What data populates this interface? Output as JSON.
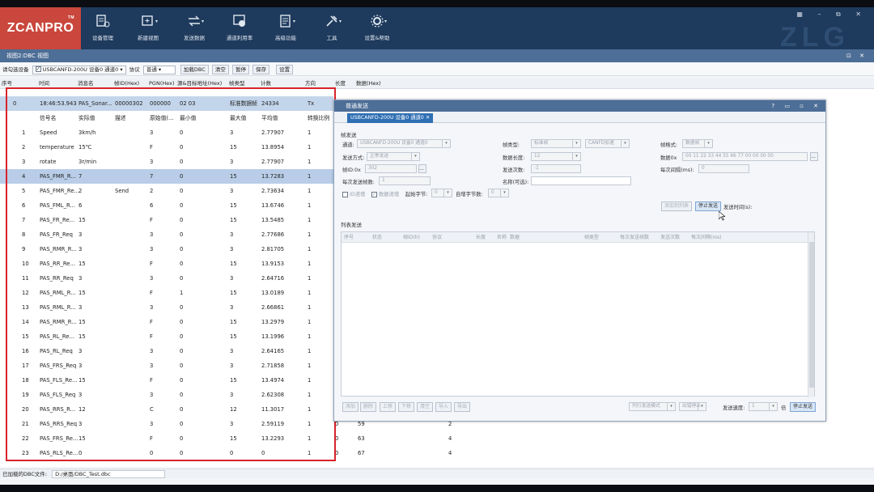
{
  "app": {
    "logo": "ZCANPRO",
    "logo_tm": "TM",
    "watermark": "ZLG",
    "ribbon": [
      {
        "label": "设备管理",
        "icon": "device-manage-icon"
      },
      {
        "label": "新建视图",
        "icon": "new-view-icon"
      },
      {
        "label": "发送数据",
        "icon": "send-data-icon"
      },
      {
        "label": "通道利用率",
        "icon": "channel-usage-icon"
      },
      {
        "label": "高级功能",
        "icon": "advanced-icon"
      },
      {
        "label": "工具",
        "icon": "tools-icon"
      },
      {
        "label": "设置&帮助",
        "icon": "settings-help-icon"
      }
    ]
  },
  "window": {
    "title": "视图2:DBC 视图",
    "controls": "⊡ ✕"
  },
  "toolbar": {
    "device_label": "请勾选设备",
    "device_value": "USBCANFD-200U 设备0 通道0",
    "protocol_label": "协议",
    "protocol_value": "普通",
    "buttons": [
      "加载DBC",
      "清空",
      "暂停",
      "保存",
      "设置"
    ]
  },
  "grid": {
    "headers": [
      "序号",
      "时间",
      "消息名",
      "帧ID(Hex)",
      "PGN(Hex)",
      "源&目标地址(Hex)",
      "帧类型",
      "计数",
      "方向",
      "长度",
      "数据(Hex)"
    ],
    "sub_headers": [
      "信号名",
      "实际值",
      "描述",
      "原始值(...",
      "最小值",
      "最大值",
      "平均值",
      "转换比例"
    ],
    "main_row": {
      "index": "0",
      "time": "18:46:53.943",
      "name": "PAS_Sonar...",
      "id": "00000302",
      "pgn": "000000",
      "addr": "02 03",
      "type": "标准数据帧",
      "count": "24334",
      "dir": "Tx"
    },
    "rows": [
      {
        "idx": "1",
        "name": "Speed",
        "value": "3km/h",
        "desc": "",
        "raw": "3",
        "min": "0",
        "max": "3",
        "avg": "2.77907",
        "ratio": "1"
      },
      {
        "idx": "2",
        "name": "temperature",
        "value": "15℃",
        "desc": "",
        "raw": "F",
        "min": "0",
        "max": "15",
        "avg": "13.8954",
        "ratio": "1"
      },
      {
        "idx": "3",
        "name": "rotate",
        "value": "3r/min",
        "desc": "",
        "raw": "3",
        "min": "0",
        "max": "3",
        "avg": "2.77907",
        "ratio": "1"
      },
      {
        "idx": "4",
        "name": "PAS_FMR_R...",
        "value": "7",
        "desc": "",
        "raw": "7",
        "min": "0",
        "max": "15",
        "avg": "13.7283",
        "ratio": "1"
      },
      {
        "idx": "5",
        "name": "PAS_FMR_Re...",
        "value": "2",
        "desc": "Send",
        "raw": "2",
        "min": "0",
        "max": "3",
        "avg": "2.73634",
        "ratio": "1"
      },
      {
        "idx": "6",
        "name": "PAS_FML_R...",
        "value": "6",
        "desc": "",
        "raw": "6",
        "min": "0",
        "max": "15",
        "avg": "13.6746",
        "ratio": "1"
      },
      {
        "idx": "7",
        "name": "PAS_FR_Re...",
        "value": "15",
        "desc": "",
        "raw": "F",
        "min": "0",
        "max": "15",
        "avg": "13.5485",
        "ratio": "1"
      },
      {
        "idx": "8",
        "name": "PAS_FR_Req",
        "value": "3",
        "desc": "",
        "raw": "3",
        "min": "0",
        "max": "3",
        "avg": "2.77686",
        "ratio": "1"
      },
      {
        "idx": "9",
        "name": "PAS_RMR_R...",
        "value": "3",
        "desc": "",
        "raw": "3",
        "min": "0",
        "max": "3",
        "avg": "2.81705",
        "ratio": "1"
      },
      {
        "idx": "10",
        "name": "PAS_RR_Re...",
        "value": "15",
        "desc": "",
        "raw": "F",
        "min": "0",
        "max": "15",
        "avg": "13.9153",
        "ratio": "1"
      },
      {
        "idx": "11",
        "name": "PAS_RR_Req",
        "value": "3",
        "desc": "",
        "raw": "3",
        "min": "0",
        "max": "3",
        "avg": "2.64716",
        "ratio": "1"
      },
      {
        "idx": "12",
        "name": "PAS_RML_R...",
        "value": "15",
        "desc": "",
        "raw": "F",
        "min": "1",
        "max": "15",
        "avg": "13.0189",
        "ratio": "1"
      },
      {
        "idx": "13",
        "name": "PAS_RML_R...",
        "value": "3",
        "desc": "",
        "raw": "3",
        "min": "0",
        "max": "3",
        "avg": "2.66861",
        "ratio": "1"
      },
      {
        "idx": "14",
        "name": "PAS_RMR_R...",
        "value": "15",
        "desc": "",
        "raw": "F",
        "min": "0",
        "max": "15",
        "avg": "13.2979",
        "ratio": "1"
      },
      {
        "idx": "15",
        "name": "PAS_RL_Re...",
        "value": "15",
        "desc": "",
        "raw": "F",
        "min": "0",
        "max": "15",
        "avg": "13.1996",
        "ratio": "1"
      },
      {
        "idx": "16",
        "name": "PAS_RL_Req",
        "value": "3",
        "desc": "",
        "raw": "3",
        "min": "0",
        "max": "3",
        "avg": "2.64165",
        "ratio": "1"
      },
      {
        "idx": "17",
        "name": "PAS_FRS_Req",
        "value": "3",
        "desc": "",
        "raw": "3",
        "min": "0",
        "max": "3",
        "avg": "2.71858",
        "ratio": "1"
      },
      {
        "idx": "18",
        "name": "PAS_FLS_Re...",
        "value": "15",
        "desc": "",
        "raw": "F",
        "min": "0",
        "max": "15",
        "avg": "13.4974",
        "ratio": "1"
      },
      {
        "idx": "19",
        "name": "PAS_FLS_Req",
        "value": "3",
        "desc": "",
        "raw": "3",
        "min": "0",
        "max": "3",
        "avg": "2.62308",
        "ratio": "1"
      },
      {
        "idx": "20",
        "name": "PAS_RRS_R...",
        "value": "12",
        "desc": "",
        "raw": "C",
        "min": "0",
        "max": "12",
        "avg": "11.3017",
        "ratio": "1"
      },
      {
        "idx": "21",
        "name": "PAS_RRS_Req",
        "value": "3",
        "desc": "",
        "raw": "3",
        "min": "0",
        "max": "3",
        "avg": "2.59119",
        "ratio": "1"
      },
      {
        "idx": "22",
        "name": "PAS_FRS_Re...",
        "value": "15",
        "desc": "",
        "raw": "F",
        "min": "0",
        "max": "15",
        "avg": "13.2293",
        "ratio": "1"
      },
      {
        "idx": "23",
        "name": "PAS_RLS_Re...",
        "value": "0",
        "desc": "",
        "raw": "0",
        "min": "0",
        "max": "0",
        "avg": "0",
        "ratio": "1"
      }
    ],
    "tail_rows": [
      {
        "a": "0",
        "b": "59",
        "c": "2"
      },
      {
        "a": "0",
        "b": "63",
        "c": "4"
      },
      {
        "a": "0",
        "b": "67",
        "c": "4"
      }
    ]
  },
  "dialog": {
    "title": "普通发送",
    "controls": "? ▭ ▫ ✕",
    "tab": "USBCANFD-200U 设备0 通道0",
    "tab_close": "✕",
    "section_frame": "帧发送",
    "channel_label": "通道:",
    "channel_value": "USBCANFD-200U 设备0 通道0",
    "frame_type_label": "帧类型:",
    "frame_type_value": "标准帧",
    "canfd_value": "CANFD加速",
    "frame_format_label": "帧格式:",
    "frame_format_value": "数据帧",
    "send_mode_label": "发送方式:",
    "send_mode_value": "正常发送",
    "data_len_label": "数据长度:",
    "data_len_value": "12",
    "data_label": "数据0x",
    "data_value": "00 11 22 33 44 55 66 77 00 00 00 00",
    "frame_id_label": "帧ID:0x",
    "frame_id_value": "302",
    "send_count_label": "发送次数:",
    "send_count_value": "-1",
    "interval_label": "每次间隔(ms):",
    "interval_value": "0",
    "per_send_label": "每次发送帧数:",
    "per_send_value": "1",
    "name_label": "名称(可选):",
    "id_inc_label": "ID递增",
    "data_inc_label": "数据递增",
    "start_byte_label": "起始字节:",
    "start_byte_value": "0",
    "inc_bytes_label": "自增字节数:",
    "inc_bytes_value": "0",
    "add_list_btn": "添加到列表",
    "stop_btn": "停止发送",
    "send_time_label": "发送时间(s):",
    "section_list": "列表发送",
    "list_headers": [
      "序号",
      "状态",
      "帧ID(h)",
      "协议",
      "长度",
      "名称",
      "数据",
      "帧类型",
      "每次发送帧数",
      "发送次数",
      "每次间隔(ms)"
    ],
    "list_buttons": [
      "添加",
      "删除",
      "上移",
      "下移",
      "清空",
      "导入",
      "导出"
    ],
    "list_mode_value": "列行发送模式",
    "list_stop_value": "出错停止",
    "speed_label": "发送速度:",
    "speed_value": "1",
    "speed_unit": "倍",
    "list_stop_btn": "停止发送"
  },
  "status": {
    "label": "已加载的DBC文件:",
    "path": "D:/桌面/DBC_Test.dbc"
  }
}
